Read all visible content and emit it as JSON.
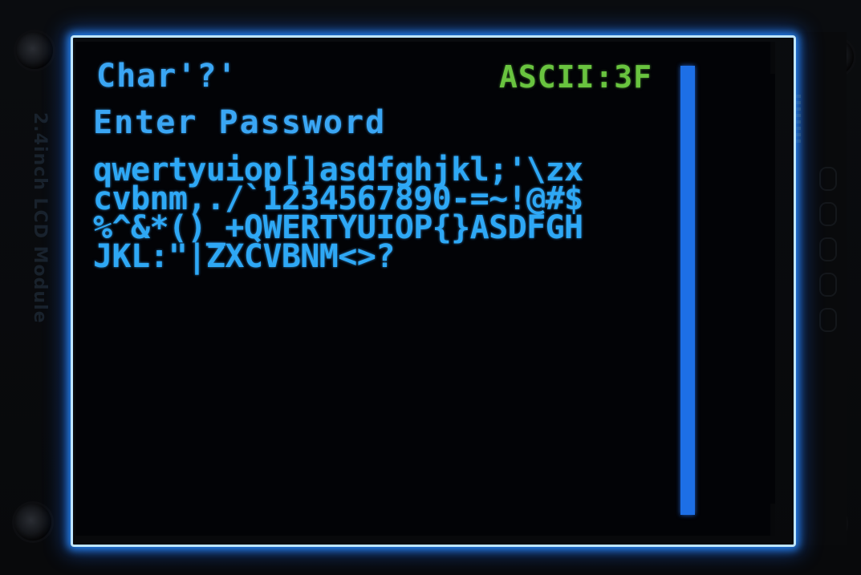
{
  "pcb": {
    "silkscreen": "2.4inch LCD Module"
  },
  "screen": {
    "char_label": "Char'?'",
    "ascii_label": "ASCII:3F",
    "prompt": "Enter Password",
    "keyboard_lines": [
      "qwertyuiop[]asdfghjkl;'\\zx",
      "cvbnm,./`1234567890-=~!@#$",
      "%^&*()_+QWERTYUIOP{}ASDFGH",
      "JKL:\"|ZXCVBNM<>?"
    ],
    "scrollbar_color": "#1d6fe6",
    "text_color": "#3aa6f4",
    "ascii_color": "#69c43f"
  }
}
